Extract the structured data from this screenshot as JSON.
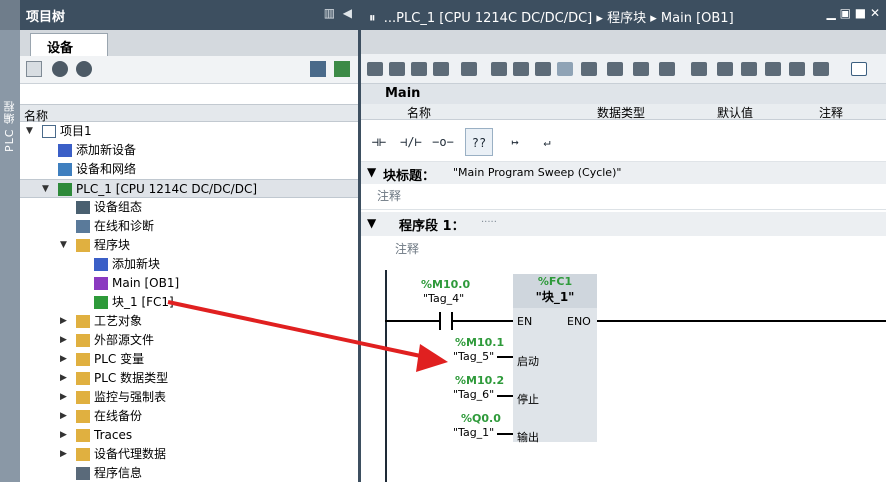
{
  "left_strip": {
    "label": "PLC 编程"
  },
  "tree_panel": {
    "title": "项目树",
    "device_tab": "设备",
    "column_header": "名称",
    "rows": [
      {
        "label": "项目1",
        "icon": "project-icon"
      },
      {
        "label": "添加新设备",
        "icon": "add-device-icon"
      },
      {
        "label": "设备和网络",
        "icon": "network-icon"
      },
      {
        "label": "PLC_1 [CPU 1214C DC/DC/DC]",
        "icon": "plc-icon"
      },
      {
        "label": "设备组态",
        "icon": "device-config-icon"
      },
      {
        "label": "在线和诊断",
        "icon": "diagnostics-icon"
      },
      {
        "label": "程序块",
        "icon": "folder-icon"
      },
      {
        "label": "添加新块",
        "icon": "add-block-icon"
      },
      {
        "label": "Main [OB1]",
        "icon": "ob-block-icon"
      },
      {
        "label": "块_1 [FC1]",
        "icon": "fc-block-icon"
      },
      {
        "label": "工艺对象",
        "icon": "folder-icon"
      },
      {
        "label": "外部源文件",
        "icon": "folder-icon"
      },
      {
        "label": "PLC 变量",
        "icon": "folder-icon"
      },
      {
        "label": "PLC 数据类型",
        "icon": "folder-icon"
      },
      {
        "label": "监控与强制表",
        "icon": "folder-icon"
      },
      {
        "label": "在线备份",
        "icon": "folder-icon"
      },
      {
        "label": "Traces",
        "icon": "folder-icon"
      },
      {
        "label": "设备代理数据",
        "icon": "folder-icon"
      },
      {
        "label": "程序信息",
        "icon": "program-info-icon"
      }
    ]
  },
  "editor": {
    "breadcrumb": {
      "prefix": "...",
      "items": [
        "PLC_1 [CPU 1214C DC/DC/DC]",
        "程序块",
        "Main [OB1]"
      ]
    },
    "interface": {
      "title": "Main",
      "columns": {
        "name": "名称",
        "data_type": "数据类型",
        "default": "默认值",
        "comment": "注释"
      }
    },
    "ladder_tools": [
      "⊣⊢",
      "⊣/⊢",
      "−o−",
      "??",
      "↦",
      "↵"
    ],
    "block_title_label": "块标题：",
    "block_title_value": "\"Main Program Sweep (Cycle)\"",
    "block_comment": "注释",
    "network_label": "程序段 1：",
    "network_dots": ".....",
    "network_comment": "注释",
    "diagram": {
      "contact_address": "%M10.0",
      "contact_tag": "\"Tag_4\"",
      "block_address": "%FC1",
      "block_name": "\"块_1\"",
      "en": "EN",
      "eno": "ENO",
      "inputs": [
        {
          "address": "%M10.1",
          "tag": "\"Tag_5\"",
          "pin": "启动"
        },
        {
          "address": "%M10.2",
          "tag": "\"Tag_6\"",
          "pin": "停止"
        },
        {
          "address": "%Q0.0",
          "tag": "\"Tag_1\"",
          "pin": "输出"
        }
      ]
    }
  },
  "colors": {
    "header_bg": "#3d4f60",
    "accent_green": "#2e9a3a",
    "arrow_red": "#e02020"
  }
}
